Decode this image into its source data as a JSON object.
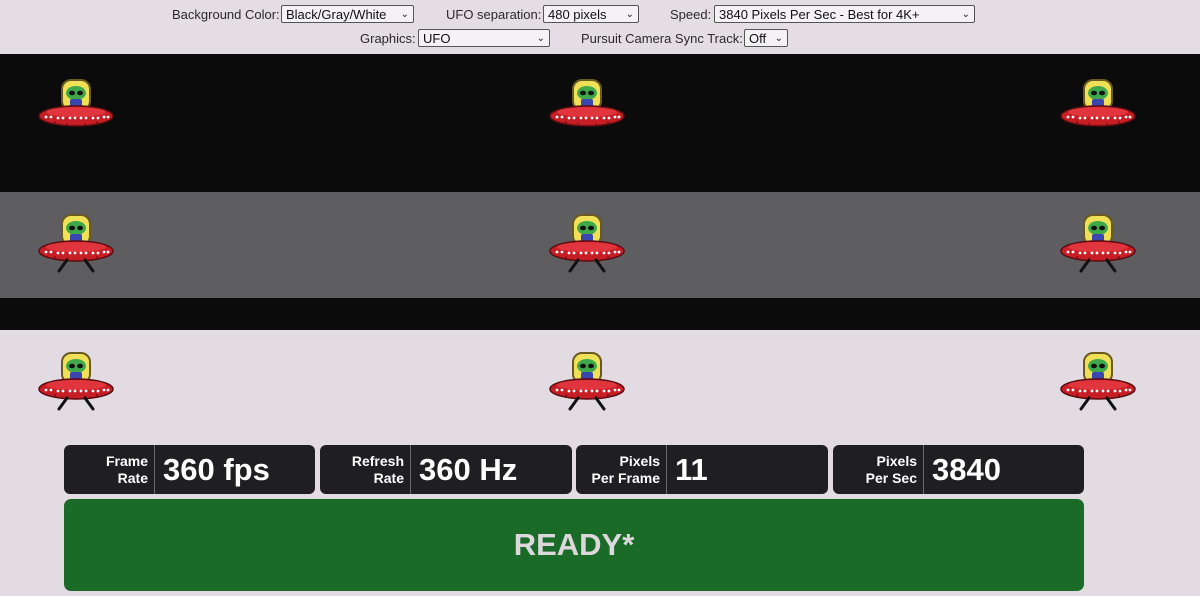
{
  "controls": {
    "background_color": {
      "label": "Background Color:",
      "value": "Black/Gray/White"
    },
    "ufo_separation": {
      "label": "UFO separation:",
      "value": "480 pixels"
    },
    "speed": {
      "label": "Speed:",
      "value": "3840 Pixels Per Sec - Best for 4K+"
    },
    "graphics": {
      "label": "Graphics:",
      "value": "UFO"
    },
    "pursuit_camera": {
      "label": "Pursuit Camera Sync Track:",
      "value": "Off"
    }
  },
  "stats": {
    "frame_rate": {
      "label_line1": "Frame",
      "label_line2": "Rate",
      "value": "360 fps"
    },
    "refresh_rate": {
      "label_line1": "Refresh",
      "label_line2": "Rate",
      "value": "360 Hz"
    },
    "pixels_per_frame": {
      "label_line1": "Pixels",
      "label_line2": "Per Frame",
      "value": "11"
    },
    "pixels_per_sec": {
      "label_line1": "Pixels",
      "label_line2": "Per Sec",
      "value": "3840"
    }
  },
  "status": {
    "text": "READY*"
  },
  "colors": {
    "band_black": "#0c0b0c",
    "band_gray": "#5e5d60",
    "band_white": "#e2dbe2",
    "stat_bg": "#1f1e20",
    "ready_bg": "#1a6b28"
  },
  "icons": {
    "ufo": "ufo-alien-icon",
    "chevron": "chevron-down-icon"
  }
}
